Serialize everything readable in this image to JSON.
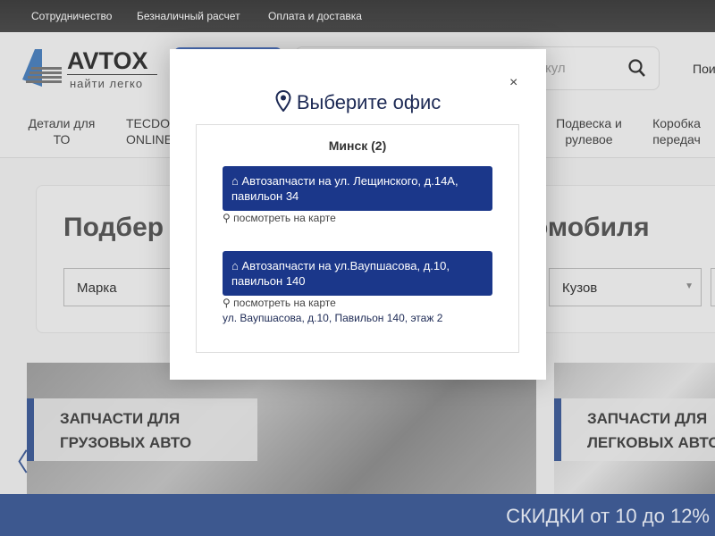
{
  "topbar": {
    "links": [
      "Сотрудничество",
      "Безналичный расчет",
      "Оплата и доставка"
    ]
  },
  "header": {
    "logo_text": "AVTOX",
    "logo_slogan": "найти легко",
    "search_placeholder": "кул",
    "search_side": "Пои"
  },
  "nav": {
    "items": [
      "Детали для ТО",
      "TECDOC ONLINE",
      "Подвеска и рулевое",
      "Коробка передач"
    ]
  },
  "selector": {
    "heading_left": "Подбер",
    "heading_right": "омобиля",
    "fields": [
      "Марка",
      "Кузов"
    ]
  },
  "banners": [
    {
      "label_line1": "ЗАПЧАСТИ ДЛЯ",
      "label_line2": "ГРУЗОВЫХ АВТО"
    },
    {
      "label_line1": "ЗАПЧАСТИ ДЛЯ",
      "label_line2": "ЛЕГКОВЫХ АВТО"
    }
  ],
  "promo": "СКИДКИ от 10 до 12%",
  "modal": {
    "title": "Выберите офис",
    "close": "×",
    "city": "Минск (2)",
    "offices": [
      {
        "name": "Автозапчасти на ул. Лещинского, д.14А, павильон 34",
        "map_link": "посмотреть на карте"
      },
      {
        "name": "Автозапчасти на ул.Ваупшасова, д.10, павильон 140",
        "map_link": "посмотреть на карте",
        "address": "ул. Ваупшасова, д.10, Павильон 140, этаж 2"
      }
    ]
  },
  "colors": {
    "accent": "#1b378a",
    "bar": "#3f5a92"
  }
}
